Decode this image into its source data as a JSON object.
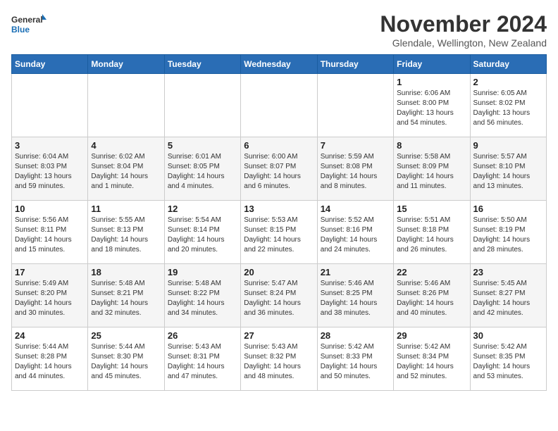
{
  "logo": {
    "line1": "General",
    "line2": "Blue"
  },
  "title": "November 2024",
  "subtitle": "Glendale, Wellington, New Zealand",
  "weekdays": [
    "Sunday",
    "Monday",
    "Tuesday",
    "Wednesday",
    "Thursday",
    "Friday",
    "Saturday"
  ],
  "weeks": [
    [
      {
        "day": "",
        "detail": ""
      },
      {
        "day": "",
        "detail": ""
      },
      {
        "day": "",
        "detail": ""
      },
      {
        "day": "",
        "detail": ""
      },
      {
        "day": "",
        "detail": ""
      },
      {
        "day": "1",
        "detail": "Sunrise: 6:06 AM\nSunset: 8:00 PM\nDaylight: 13 hours\nand 54 minutes."
      },
      {
        "day": "2",
        "detail": "Sunrise: 6:05 AM\nSunset: 8:02 PM\nDaylight: 13 hours\nand 56 minutes."
      }
    ],
    [
      {
        "day": "3",
        "detail": "Sunrise: 6:04 AM\nSunset: 8:03 PM\nDaylight: 13 hours\nand 59 minutes."
      },
      {
        "day": "4",
        "detail": "Sunrise: 6:02 AM\nSunset: 8:04 PM\nDaylight: 14 hours\nand 1 minute."
      },
      {
        "day": "5",
        "detail": "Sunrise: 6:01 AM\nSunset: 8:05 PM\nDaylight: 14 hours\nand 4 minutes."
      },
      {
        "day": "6",
        "detail": "Sunrise: 6:00 AM\nSunset: 8:07 PM\nDaylight: 14 hours\nand 6 minutes."
      },
      {
        "day": "7",
        "detail": "Sunrise: 5:59 AM\nSunset: 8:08 PM\nDaylight: 14 hours\nand 8 minutes."
      },
      {
        "day": "8",
        "detail": "Sunrise: 5:58 AM\nSunset: 8:09 PM\nDaylight: 14 hours\nand 11 minutes."
      },
      {
        "day": "9",
        "detail": "Sunrise: 5:57 AM\nSunset: 8:10 PM\nDaylight: 14 hours\nand 13 minutes."
      }
    ],
    [
      {
        "day": "10",
        "detail": "Sunrise: 5:56 AM\nSunset: 8:11 PM\nDaylight: 14 hours\nand 15 minutes."
      },
      {
        "day": "11",
        "detail": "Sunrise: 5:55 AM\nSunset: 8:13 PM\nDaylight: 14 hours\nand 18 minutes."
      },
      {
        "day": "12",
        "detail": "Sunrise: 5:54 AM\nSunset: 8:14 PM\nDaylight: 14 hours\nand 20 minutes."
      },
      {
        "day": "13",
        "detail": "Sunrise: 5:53 AM\nSunset: 8:15 PM\nDaylight: 14 hours\nand 22 minutes."
      },
      {
        "day": "14",
        "detail": "Sunrise: 5:52 AM\nSunset: 8:16 PM\nDaylight: 14 hours\nand 24 minutes."
      },
      {
        "day": "15",
        "detail": "Sunrise: 5:51 AM\nSunset: 8:18 PM\nDaylight: 14 hours\nand 26 minutes."
      },
      {
        "day": "16",
        "detail": "Sunrise: 5:50 AM\nSunset: 8:19 PM\nDaylight: 14 hours\nand 28 minutes."
      }
    ],
    [
      {
        "day": "17",
        "detail": "Sunrise: 5:49 AM\nSunset: 8:20 PM\nDaylight: 14 hours\nand 30 minutes."
      },
      {
        "day": "18",
        "detail": "Sunrise: 5:48 AM\nSunset: 8:21 PM\nDaylight: 14 hours\nand 32 minutes."
      },
      {
        "day": "19",
        "detail": "Sunrise: 5:48 AM\nSunset: 8:22 PM\nDaylight: 14 hours\nand 34 minutes."
      },
      {
        "day": "20",
        "detail": "Sunrise: 5:47 AM\nSunset: 8:24 PM\nDaylight: 14 hours\nand 36 minutes."
      },
      {
        "day": "21",
        "detail": "Sunrise: 5:46 AM\nSunset: 8:25 PM\nDaylight: 14 hours\nand 38 minutes."
      },
      {
        "day": "22",
        "detail": "Sunrise: 5:46 AM\nSunset: 8:26 PM\nDaylight: 14 hours\nand 40 minutes."
      },
      {
        "day": "23",
        "detail": "Sunrise: 5:45 AM\nSunset: 8:27 PM\nDaylight: 14 hours\nand 42 minutes."
      }
    ],
    [
      {
        "day": "24",
        "detail": "Sunrise: 5:44 AM\nSunset: 8:28 PM\nDaylight: 14 hours\nand 44 minutes."
      },
      {
        "day": "25",
        "detail": "Sunrise: 5:44 AM\nSunset: 8:30 PM\nDaylight: 14 hours\nand 45 minutes."
      },
      {
        "day": "26",
        "detail": "Sunrise: 5:43 AM\nSunset: 8:31 PM\nDaylight: 14 hours\nand 47 minutes."
      },
      {
        "day": "27",
        "detail": "Sunrise: 5:43 AM\nSunset: 8:32 PM\nDaylight: 14 hours\nand 48 minutes."
      },
      {
        "day": "28",
        "detail": "Sunrise: 5:42 AM\nSunset: 8:33 PM\nDaylight: 14 hours\nand 50 minutes."
      },
      {
        "day": "29",
        "detail": "Sunrise: 5:42 AM\nSunset: 8:34 PM\nDaylight: 14 hours\nand 52 minutes."
      },
      {
        "day": "30",
        "detail": "Sunrise: 5:42 AM\nSunset: 8:35 PM\nDaylight: 14 hours\nand 53 minutes."
      }
    ]
  ]
}
